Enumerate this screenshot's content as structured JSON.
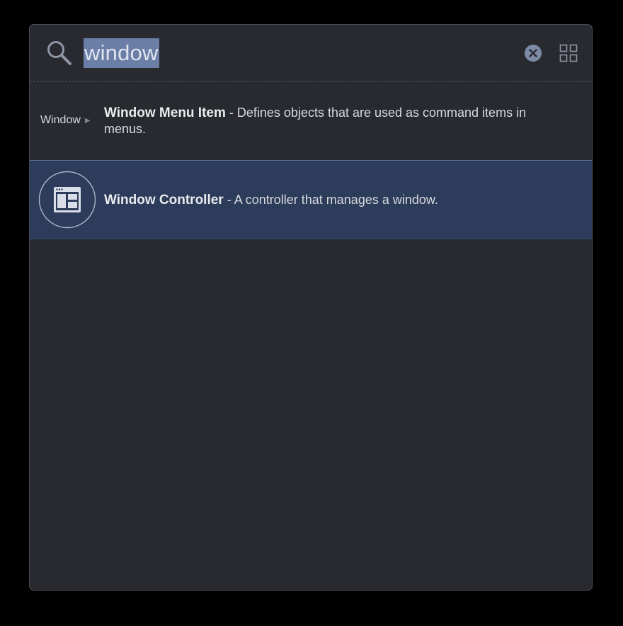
{
  "search": {
    "query": "window"
  },
  "results": [
    {
      "breadcrumb": "Window",
      "title": "Window Menu Item",
      "separator": " - ",
      "description": "Defines objects that are used as command items in menus."
    },
    {
      "title": "Window Controller",
      "separator": " - ",
      "description": "A controller that manages a window.",
      "icon": "window-controller-icon",
      "selected": true
    }
  ],
  "icons": {
    "search": "search-icon",
    "clear": "clear-search-icon",
    "grid": "grid-view-icon"
  },
  "colors": {
    "panel_bg": "#292a2f",
    "selection_bg": "#2c3c5a",
    "text_highlight": "#6b7ea6"
  }
}
